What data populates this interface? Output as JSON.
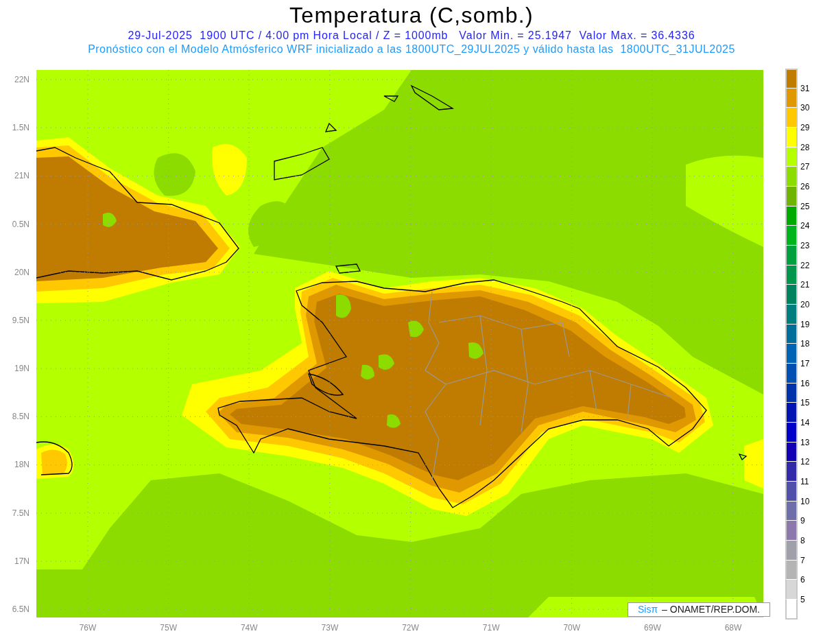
{
  "title": "Temperatura (C,somb.)",
  "subtitle": "29-Jul-2025  1900 UTC / 4:00 pm Hora Local / Z = 1000mb   Valor Min. = 25.1947  Valor Max. = 36.4336",
  "forecast_note": "Pronóstico con el Modelo Atmósferico WRF inicializado a las 1800UTC_29JUL2025 y válido hasta las  1800UTC_31JUL2025",
  "lat_labels": [
    "22N",
    "1.5N",
    "21N",
    "0.5N",
    "20N",
    "9.5N",
    "19N",
    "8.5N",
    "18N",
    "7.5N",
    "17N",
    "6.5N"
  ],
  "lon_labels": [
    "76W",
    "75W",
    "74W",
    "73W",
    "72W",
    "71W",
    "70W",
    "69W",
    "68W"
  ],
  "credit": {
    "logo": "Sisπ",
    "text": "– ONAMET/REP.DOM."
  },
  "colorbar": {
    "labels": [
      "31",
      "30",
      "29",
      "28",
      "27",
      "26",
      "25",
      "24",
      "23",
      "22",
      "21",
      "20",
      "19",
      "18",
      "17",
      "16",
      "15",
      "14",
      "13",
      "12",
      "11",
      "10",
      "9",
      "8",
      "7",
      "6",
      "5"
    ],
    "segments": [
      {
        "color": "#bf7c00"
      },
      {
        "color": "#e09800"
      },
      {
        "color": "#ffc800"
      },
      {
        "color": "#ffff00"
      },
      {
        "color": "#b4ff00"
      },
      {
        "color": "#8cdc00"
      },
      {
        "color": "#6eb400"
      },
      {
        "color": "#00aa00"
      },
      {
        "color": "#00b41e"
      },
      {
        "color": "#00a03c"
      },
      {
        "color": "#00964b"
      },
      {
        "color": "#00825f"
      },
      {
        "color": "#007d7d"
      },
      {
        "color": "#006e9b"
      },
      {
        "color": "#0064b4"
      },
      {
        "color": "#0050b4"
      },
      {
        "color": "#0032aa"
      },
      {
        "color": "#0014b4"
      },
      {
        "color": "#0000c8"
      },
      {
        "color": "#1400b4"
      },
      {
        "color": "#3228aa"
      },
      {
        "color": "#5050aa"
      },
      {
        "color": "#6e6eaa"
      },
      {
        "color": "#8c78aa"
      },
      {
        "color": "#a0a0aa"
      },
      {
        "color": "#b4b4b4"
      },
      {
        "color": "#d7d7d7"
      },
      {
        "color": "#ffffff"
      }
    ]
  }
}
